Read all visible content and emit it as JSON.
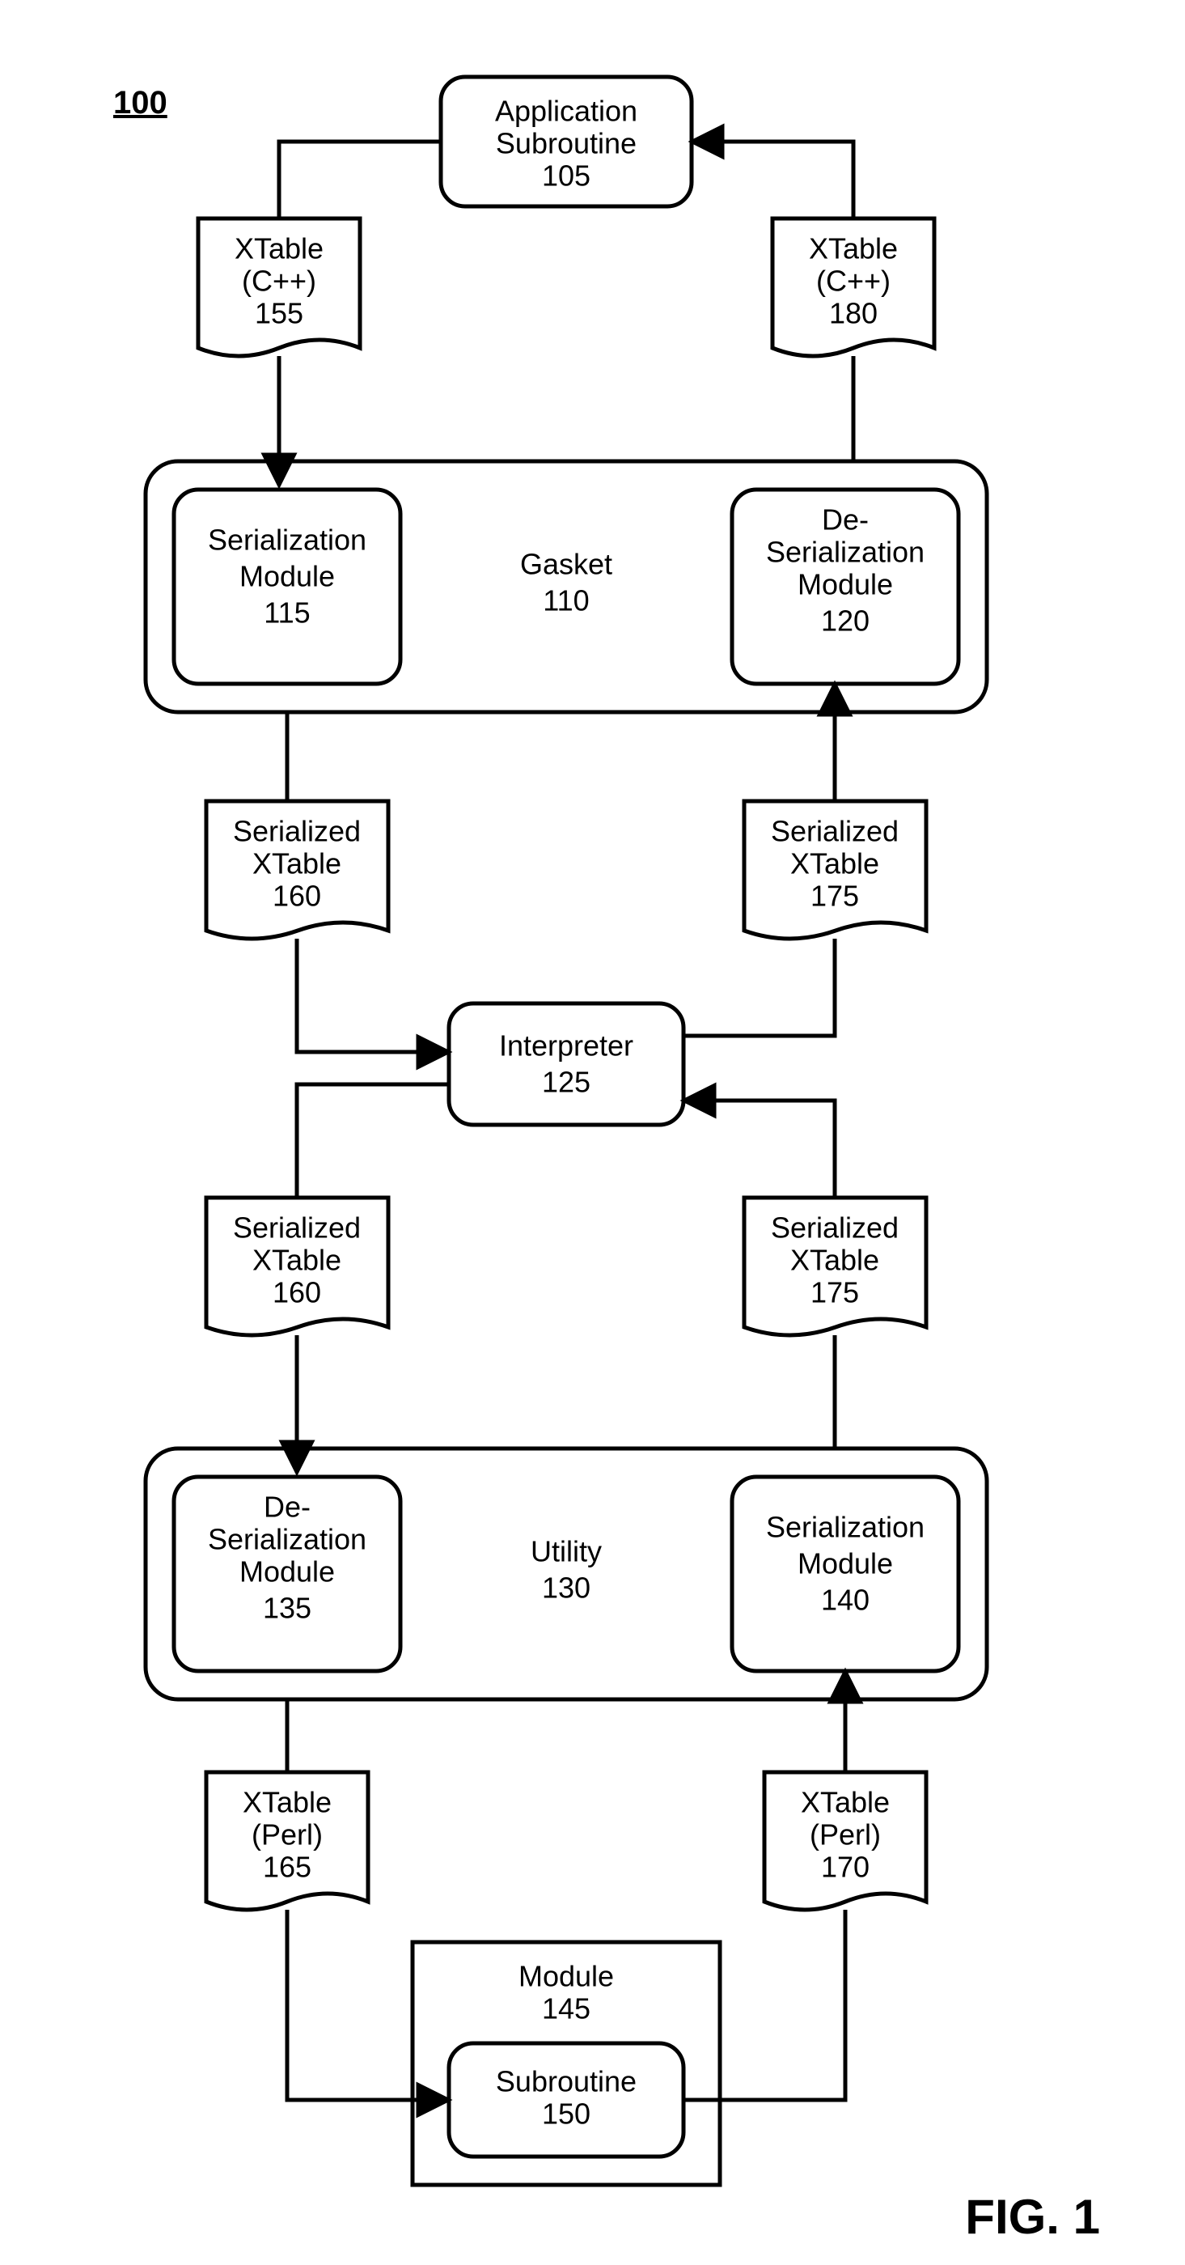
{
  "figure_ref": "100",
  "figure_label": "FIG. 1",
  "nodes": {
    "app_sub": {
      "l1": "Application",
      "l2": "Subroutine",
      "num": "105"
    },
    "xtable_cpp_left": {
      "l1": "XTable",
      "l2": "(C++)",
      "num": "155"
    },
    "xtable_cpp_right": {
      "l1": "XTable",
      "l2": "(C++)",
      "num": "180"
    },
    "gasket": {
      "label": "Gasket",
      "num": "110"
    },
    "ser_mod_top": {
      "l1": "Serialization",
      "l2": "Module",
      "num": "115"
    },
    "deser_mod_top": {
      "l1": "De-",
      "l2": "Serialization",
      "l3": "Module",
      "num": "120"
    },
    "ser_xtable_tl": {
      "l1": "Serialized",
      "l2": "XTable",
      "num": "160"
    },
    "ser_xtable_tr": {
      "l1": "Serialized",
      "l2": "XTable",
      "num": "175"
    },
    "interpreter": {
      "l1": "Interpreter",
      "num": "125"
    },
    "ser_xtable_bl": {
      "l1": "Serialized",
      "l2": "XTable",
      "num": "160"
    },
    "ser_xtable_br": {
      "l1": "Serialized",
      "l2": "XTable",
      "num": "175"
    },
    "utility": {
      "label": "Utility",
      "num": "130"
    },
    "deser_mod_bot": {
      "l1": "De-",
      "l2": "Serialization",
      "l3": "Module",
      "num": "135"
    },
    "ser_mod_bot": {
      "l1": "Serialization",
      "l2": "Module",
      "num": "140"
    },
    "xtable_perl_left": {
      "l1": "XTable",
      "l2": "(Perl)",
      "num": "165"
    },
    "xtable_perl_right": {
      "l1": "XTable",
      "l2": "(Perl)",
      "num": "170"
    },
    "module": {
      "label": "Module",
      "num": "145"
    },
    "subroutine": {
      "label": "Subroutine",
      "num": "150"
    }
  }
}
